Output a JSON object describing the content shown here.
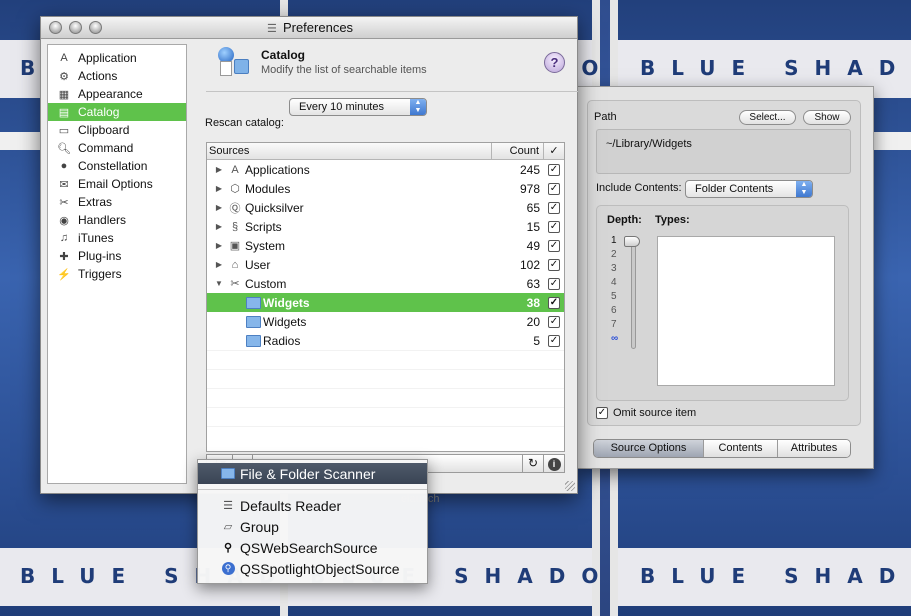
{
  "window": {
    "title": "Preferences"
  },
  "sidebar": {
    "items": [
      {
        "label": "Application",
        "icon": "app-a-icon"
      },
      {
        "label": "Actions",
        "icon": "gear-icon"
      },
      {
        "label": "Appearance",
        "icon": "appearance-icon"
      },
      {
        "label": "Catalog",
        "icon": "catalog-icon",
        "selected": true
      },
      {
        "label": "Clipboard",
        "icon": "clipboard-icon"
      },
      {
        "label": "Command",
        "icon": "magnifier-icon"
      },
      {
        "label": "Constellation",
        "icon": "constellation-icon"
      },
      {
        "label": "Email Options",
        "icon": "email-icon"
      },
      {
        "label": "Extras",
        "icon": "tools-icon"
      },
      {
        "label": "Handlers",
        "icon": "handlers-icon"
      },
      {
        "label": "iTunes",
        "icon": "itunes-icon"
      },
      {
        "label": "Plug-ins",
        "icon": "puzzle-icon"
      },
      {
        "label": "Triggers",
        "icon": "triggers-icon"
      }
    ]
  },
  "header": {
    "title": "Catalog",
    "subtitle": "Modify the list of searchable items",
    "help": "?"
  },
  "rescan": {
    "label": "Rescan catalog:",
    "value": "Every 10 minutes"
  },
  "table": {
    "col_sources": "Sources",
    "col_count": "Count",
    "col_check": "✓",
    "rows": [
      {
        "name": "Applications",
        "count": "245",
        "icon": "applications-icon"
      },
      {
        "name": "Modules",
        "count": "978",
        "icon": "modules-icon"
      },
      {
        "name": "Quicksilver",
        "count": "65",
        "icon": "quicksilver-icon"
      },
      {
        "name": "Scripts",
        "count": "15",
        "icon": "scripts-icon"
      },
      {
        "name": "System",
        "count": "49",
        "icon": "system-icon"
      },
      {
        "name": "User",
        "count": "102",
        "icon": "house-icon"
      },
      {
        "name": "Custom",
        "count": "63",
        "icon": "tools-icon"
      },
      {
        "name": "Widgets",
        "count": "38",
        "icon": "folder-icon"
      },
      {
        "name": "Widgets",
        "count": "20",
        "icon": "folder-icon"
      },
      {
        "name": "Radios",
        "count": "5",
        "icon": "folder-icon"
      }
    ]
  },
  "footer": {
    "add": "+▾",
    "remove": "−",
    "refresh": "↻",
    "info": "i",
    "status": "elaunch"
  },
  "drawer": {
    "path_label": "Path",
    "select_btn": "Select...",
    "show_btn": "Show",
    "path_value": "~/Library/Widgets",
    "include_label": "Include Contents:",
    "include_value": "Folder Contents",
    "depth_label": "Depth:",
    "types_label": "Types:",
    "depth_values": [
      "1",
      "2",
      "3",
      "4",
      "5",
      "6",
      "7",
      "∞"
    ],
    "depth_selected": "1",
    "omit_label": "Omit source item",
    "tabs": [
      "Source Options",
      "Contents",
      "Attributes"
    ]
  },
  "menu": {
    "items": [
      {
        "label": "File & Folder Scanner",
        "icon": "folder-icon"
      },
      {
        "label": "Defaults Reader",
        "icon": "list-icon"
      },
      {
        "label": "Group",
        "icon": "group-folder-icon"
      },
      {
        "label": "QSWebSearchSource",
        "icon": "magnifier-icon"
      },
      {
        "label": "QSSpotlightObjectSource",
        "icon": "spotlight-icon"
      }
    ]
  },
  "desktop": {
    "poster_text": "BLUE SHADOW"
  }
}
